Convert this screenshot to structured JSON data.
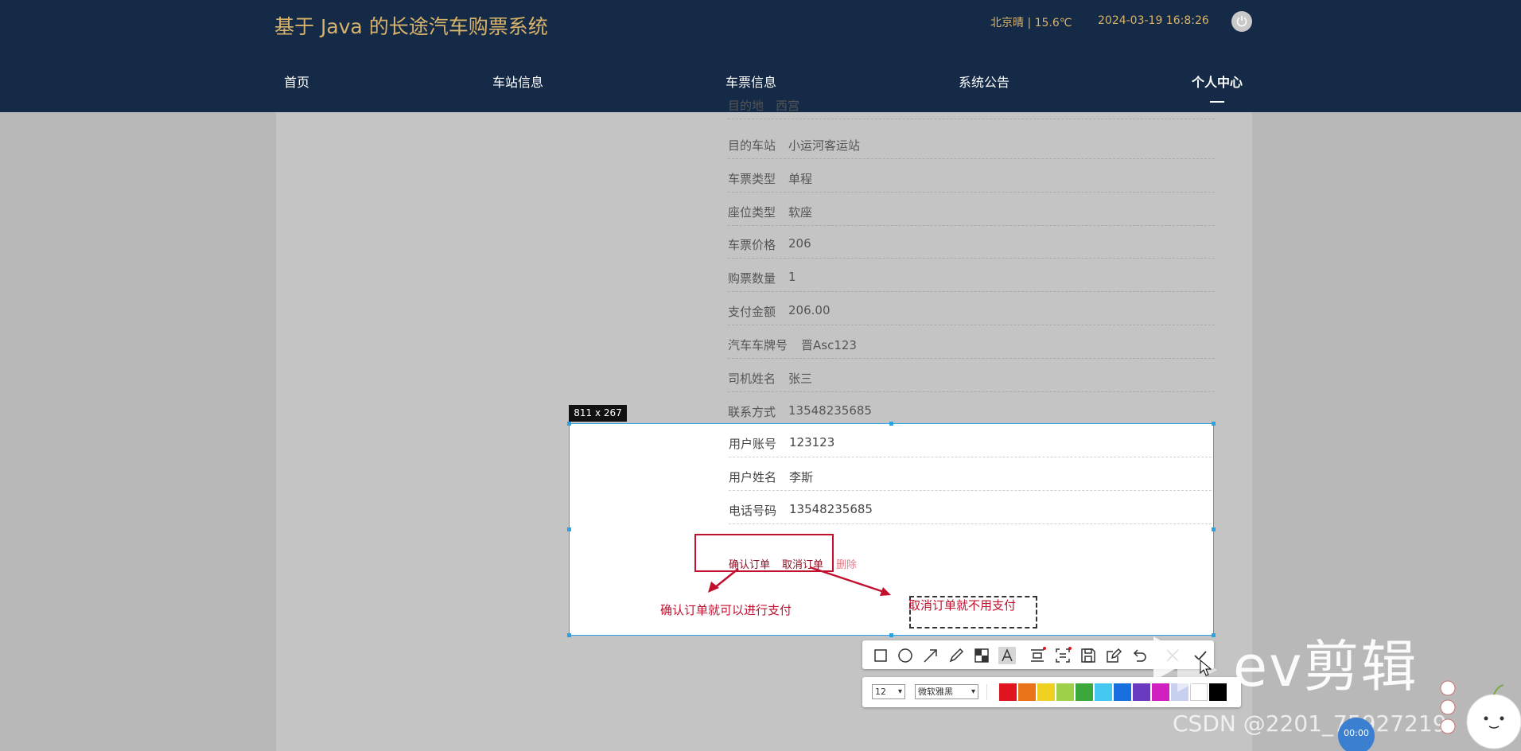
{
  "header": {
    "title": "基于 Java 的长途汽车购票系统",
    "weather": "北京晴 | 15.6℃",
    "datetime": "2024-03-19   16:8:26",
    "nav": [
      "首页",
      "车站信息",
      "车票信息",
      "系统公告",
      "个人中心"
    ],
    "active_nav": "个人中心"
  },
  "details": {
    "partial_label": "目的地",
    "partial_value": "西宫",
    "rows": [
      {
        "label": "目的车站",
        "value": "小运河客运站"
      },
      {
        "label": "车票类型",
        "value": "单程"
      },
      {
        "label": "座位类型",
        "value": "软座"
      },
      {
        "label": "车票价格",
        "value": "206"
      },
      {
        "label": "购票数量",
        "value": "1"
      },
      {
        "label": "支付金额",
        "value": "206.00"
      },
      {
        "label": "汽车车牌号",
        "value": "晋Asc123"
      },
      {
        "label": "司机姓名",
        "value": "张三"
      },
      {
        "label": "联系方式",
        "value": "13548235685"
      }
    ],
    "selected_rows": [
      {
        "label": "用户账号",
        "value": "123123"
      },
      {
        "label": "用户姓名",
        "value": "李斯"
      },
      {
        "label": "电话号码",
        "value": "13548235685"
      }
    ]
  },
  "actions": {
    "confirm": "确认订单",
    "cancel": "取消订单",
    "delete": "删除"
  },
  "annotations": {
    "confirm_note": "确认订单就可以进行支付",
    "cancel_note": "取消订单就不用支付"
  },
  "capture": {
    "size_label": "811 x 267",
    "font_size": "12",
    "font_name": "微软雅黑",
    "colors": [
      "#e0141e",
      "#e8731a",
      "#f0d020",
      "#9ed04a",
      "#3aa83a",
      "#44c8f0",
      "#1a6fe0",
      "#6a3ac0",
      "#d020c0",
      "#c8d0f0",
      "#ffffff",
      "#000000"
    ]
  },
  "watermarks": {
    "editor": "ev剪辑",
    "csdn": "CSDN @2201_75927219",
    "timer": "00:00"
  }
}
